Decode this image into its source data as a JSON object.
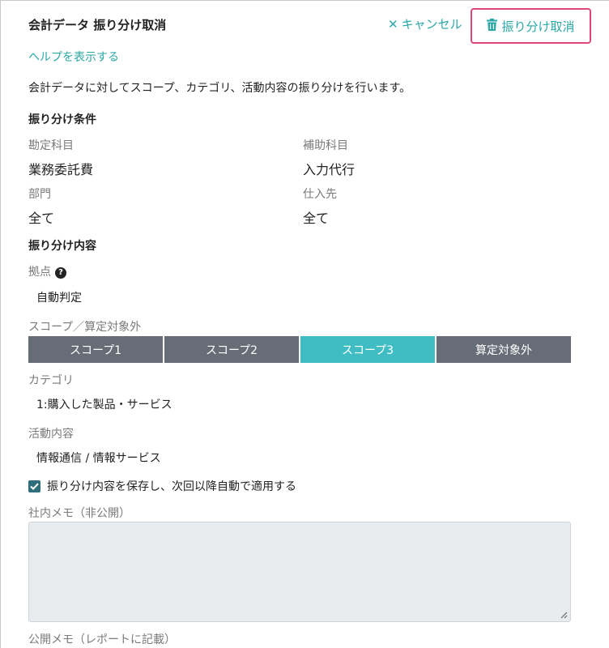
{
  "header": {
    "title": "会計データ 振り分け取消",
    "cancel_label": "キャンセル",
    "undo_label": "振り分け取消"
  },
  "help_link": "ヘルプを表示する",
  "description": "会計データに対してスコープ、カテゴリ、活動内容の振り分けを行います。",
  "conditions": {
    "title": "振り分け条件",
    "account_label": "勘定科目",
    "account_value": "業務委託費",
    "sub_account_label": "補助科目",
    "sub_account_value": "入力代行",
    "department_label": "部門",
    "department_value": "全て",
    "supplier_label": "仕入先",
    "supplier_value": "全て"
  },
  "content": {
    "title": "振り分け内容",
    "base_label": "拠点",
    "base_value": "自動判定",
    "scope_label": "スコープ／算定対象外",
    "scope_options": [
      "スコープ1",
      "スコープ2",
      "スコープ3",
      "算定対象外"
    ],
    "scope_selected": "スコープ3",
    "category_label": "カテゴリ",
    "category_value": "1:購入した製品・サービス",
    "activity_label": "活動内容",
    "activity_value": "情報通信 / 情報サービス",
    "save_checkbox_label": "振り分け内容を保存し、次回以降自動で適用する",
    "save_checked": true,
    "internal_memo_label": "社内メモ（非公開）",
    "public_memo_label": "公開メモ（レポートに記載）"
  },
  "colors": {
    "accent": "#2aa7a7",
    "highlight_border": "#e0457b",
    "segment_default": "#676d76",
    "segment_active": "#3fbcc4"
  }
}
